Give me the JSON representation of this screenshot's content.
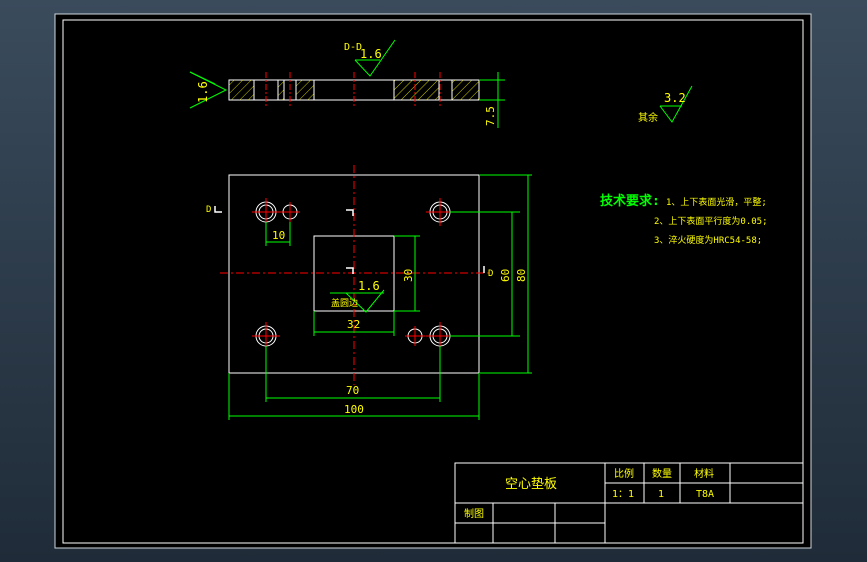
{
  "section_view": {
    "label": "D-D",
    "roughness": "1.6",
    "side_roughness": "1.6",
    "thickness_dim": "7.5"
  },
  "other_roughness": {
    "label": "其余",
    "value": "3.2"
  },
  "plan_view": {
    "section_marker": "D",
    "section_marker_right": "D",
    "dim_hole_spacing": "10",
    "dim_window_height": "30",
    "dim_window_width": "32",
    "dim_height_inner": "60",
    "dim_height_outer": "80",
    "dim_hole_pitch": "70",
    "dim_width_overall": "100",
    "window_roughness": "1.6",
    "window_note": "盖圆边"
  },
  "tech_requirements": {
    "title": "技术要求:",
    "items": [
      "1、上下表面光滑，平整;",
      "2、上下表面平行度为0.05;",
      "3、淬火硬度为HRC54-58;"
    ]
  },
  "title_block": {
    "part_name": "空心垫板",
    "scale_label": "比例",
    "quantity_label": "数量",
    "material_label": "材料",
    "scale_value": "1：1",
    "quantity_value": "1",
    "material_value": "T8A",
    "drawn_label": "制图"
  },
  "colors": {
    "background": "#000000",
    "frame": "#ffffff",
    "dimension": "#00ff00",
    "centerline": "#ff0000",
    "annotation": "#ffff00"
  }
}
